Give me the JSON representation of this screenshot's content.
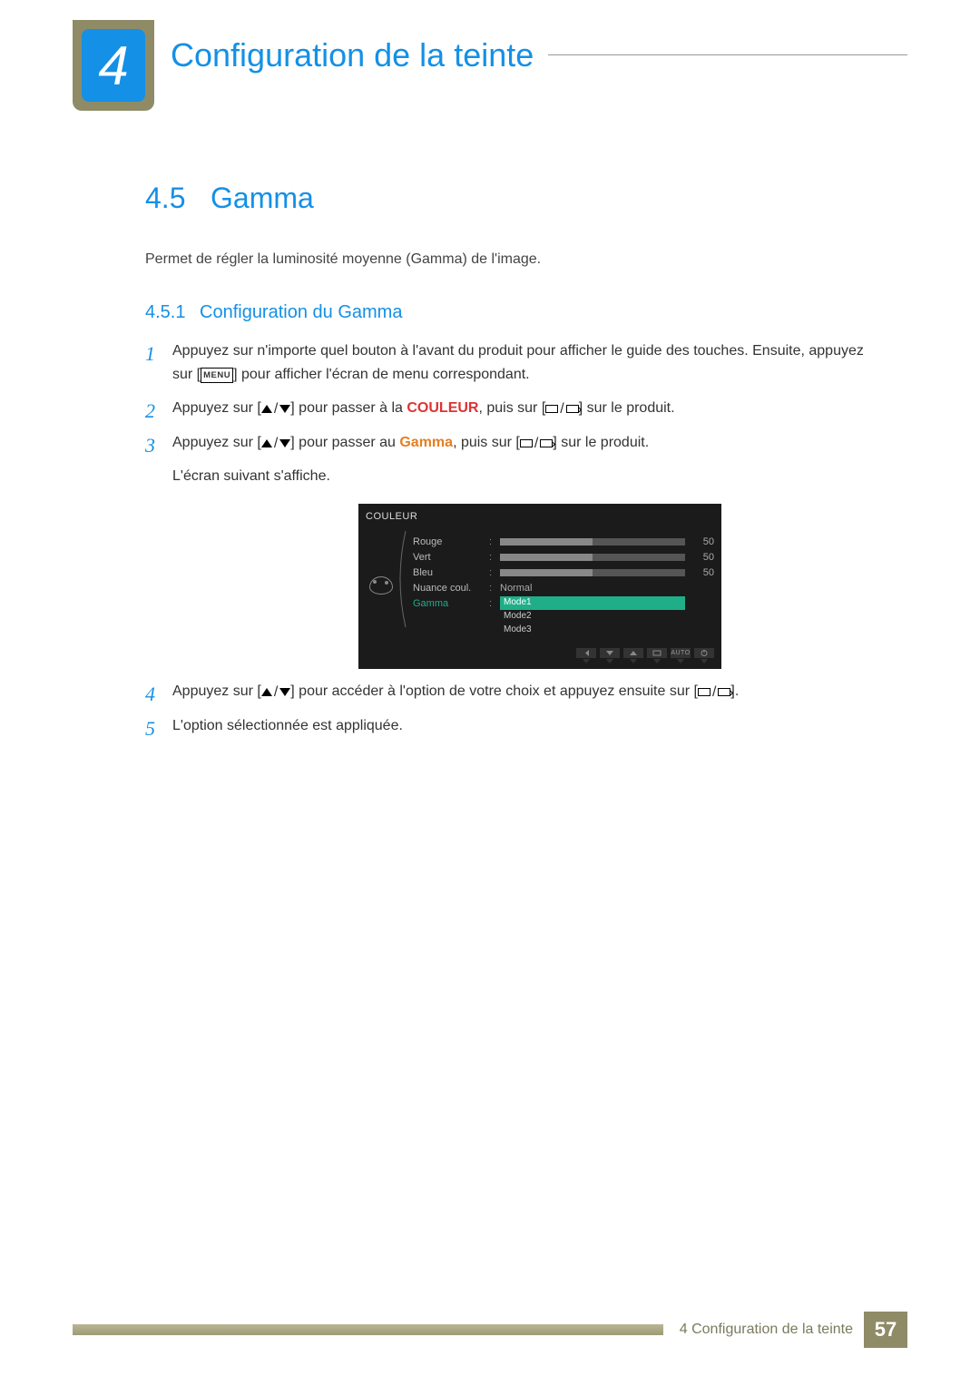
{
  "chapter": {
    "number": "4",
    "title": "Configuration de la teinte"
  },
  "section": {
    "num": "4.5",
    "title": "Gamma"
  },
  "intro": "Permet de régler la luminosité moyenne (Gamma) de l'image.",
  "subsection": {
    "num": "4.5.1",
    "title": "Configuration du Gamma"
  },
  "steps": {
    "s1a": "Appuyez sur n'importe quel bouton à l'avant du produit pour afficher le guide des touches. Ensuite, appuyez sur [",
    "s1b": "] pour afficher l'écran de menu correspondant.",
    "menu": "MENU",
    "s2a": "Appuyez sur [",
    "s2b": "] pour passer à la ",
    "s2c": ", puis sur [",
    "s2d": "] sur le produit.",
    "couleur": "COULEUR",
    "s3a": "Appuyez sur [",
    "s3b": "] pour passer au ",
    "s3c": ", puis sur [",
    "s3d": "] sur le produit.",
    "gamma": "Gamma",
    "s3e": "L'écran suivant s'affiche.",
    "s4a": "Appuyez sur [",
    "s4b": "] pour accéder à l'option de votre choix et appuyez ensuite sur [",
    "s4c": "].",
    "s5": "L'option sélectionnée est appliquée."
  },
  "osd": {
    "title": "COULEUR",
    "rows": [
      {
        "label": "Rouge",
        "value": "50"
      },
      {
        "label": "Vert",
        "value": "50"
      },
      {
        "label": "Bleu",
        "value": "50"
      }
    ],
    "nuance_label": "Nuance coul.",
    "nuance_value": "Normal",
    "gamma_label": "Gamma",
    "options": [
      "Mode1",
      "Mode2",
      "Mode3"
    ],
    "auto": "AUTO"
  },
  "footer": {
    "text": "4 Configuration de la teinte",
    "page": "57"
  }
}
